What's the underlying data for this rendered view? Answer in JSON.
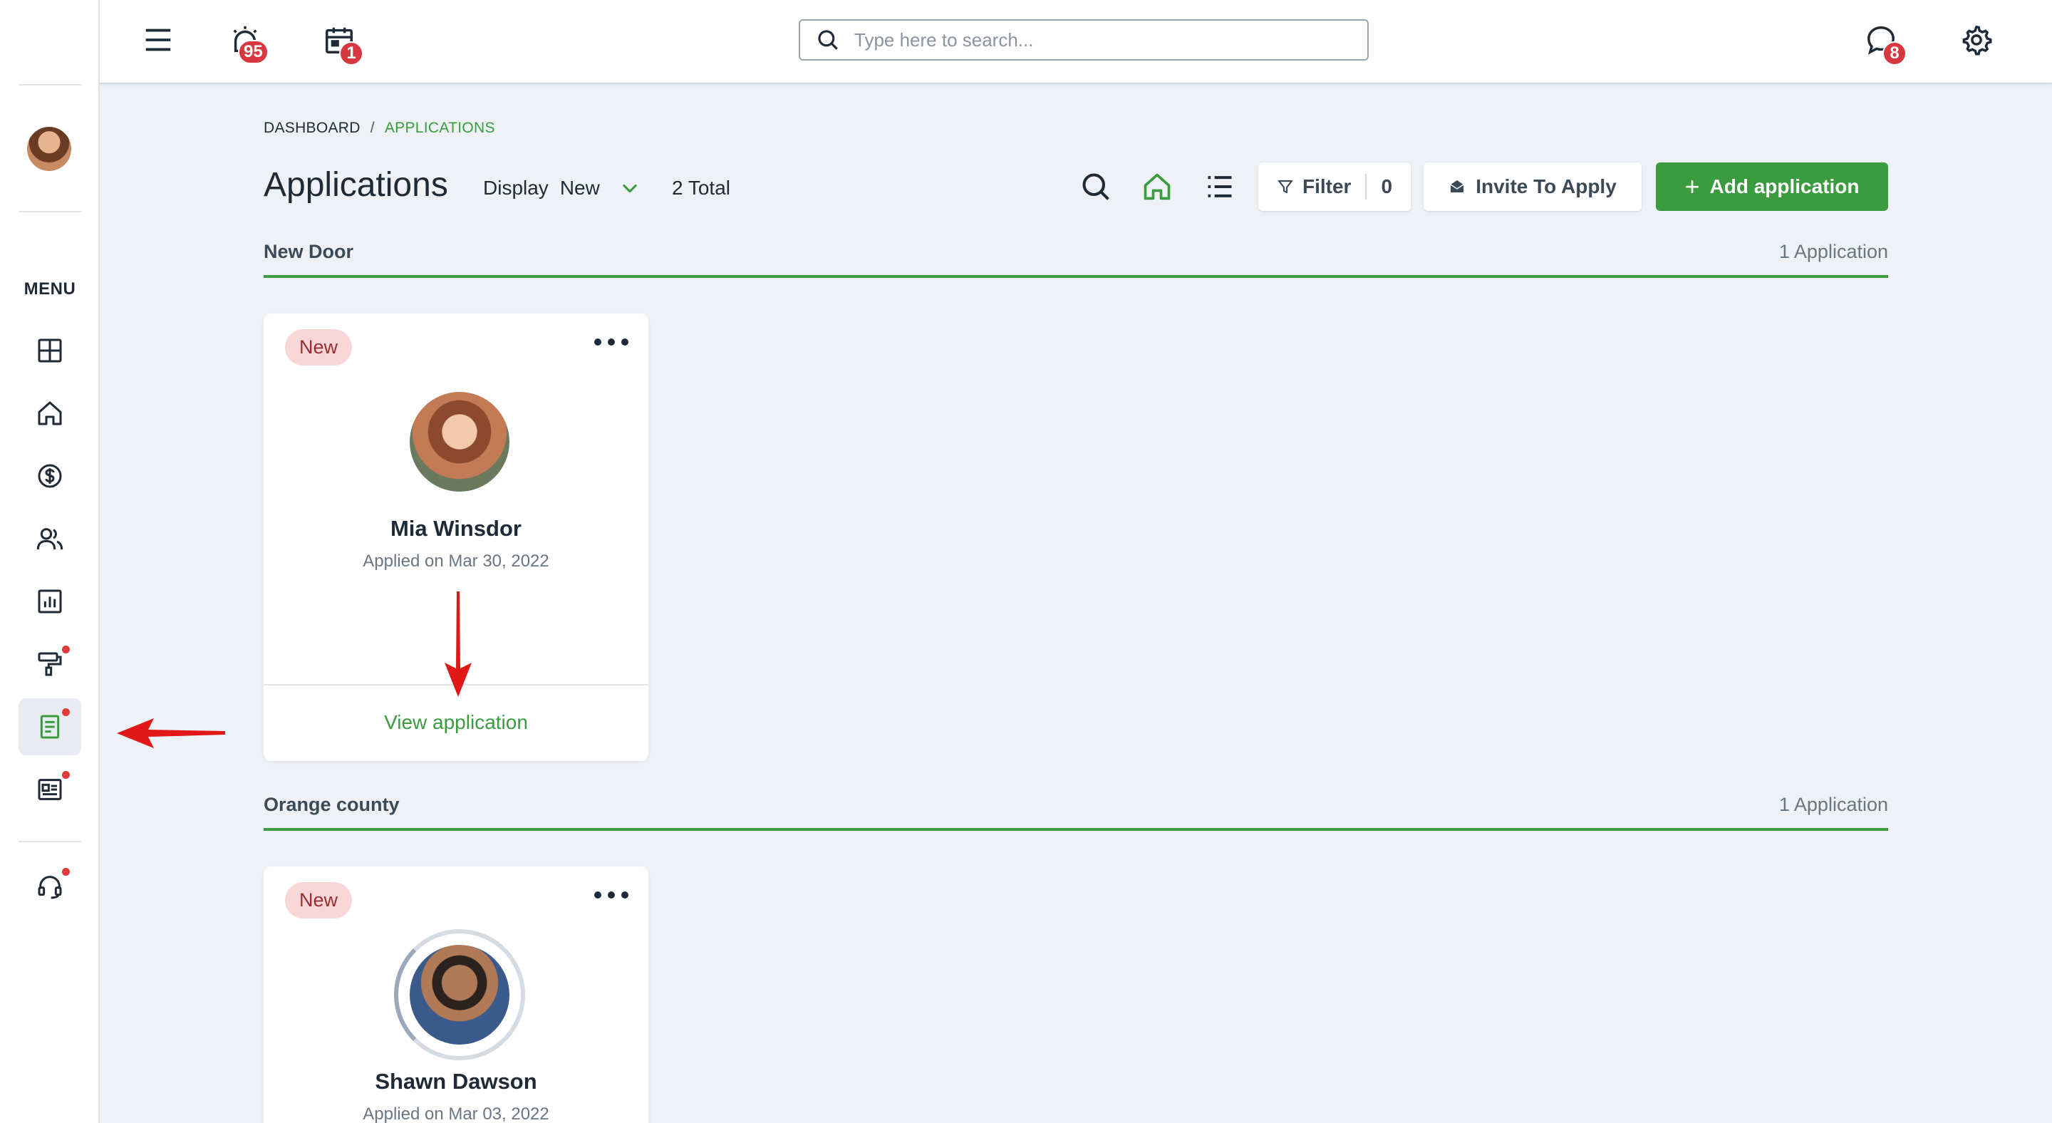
{
  "sidebar": {
    "menu_label": "MENU",
    "items": [
      {
        "name": "dashboard-icon"
      },
      {
        "name": "home-icon"
      },
      {
        "name": "dollar-icon"
      },
      {
        "name": "people-icon"
      },
      {
        "name": "chart-icon"
      },
      {
        "name": "paint-roller-icon",
        "dot": true
      },
      {
        "name": "document-icon",
        "dot": true,
        "active": true
      },
      {
        "name": "newspaper-icon",
        "dot": true
      },
      {
        "name": "headset-icon",
        "dot": true
      }
    ]
  },
  "topbar": {
    "alarm_badge": "95",
    "calendar_badge": "1",
    "chat_badge": "8",
    "search_placeholder": "Type here to search..."
  },
  "breadcrumb": {
    "root": "DASHBOARD",
    "separator": "/",
    "current": "APPLICATIONS"
  },
  "header": {
    "title": "Applications",
    "display_label": "Display",
    "display_value": "New",
    "total": "2 Total",
    "filter_label": "Filter",
    "filter_count": "0",
    "invite_label": "Invite To Apply",
    "add_label": "Add application",
    "add_plus": "+"
  },
  "groups": [
    {
      "name": "New Door",
      "count": "1 Application",
      "card": {
        "status": "New",
        "applicant": "Mia Winsdor",
        "applied": "Applied on Mar 30, 2022",
        "link": "View application"
      }
    },
    {
      "name": "Orange county",
      "count": "1 Application",
      "card": {
        "status": "New",
        "applicant": "Shawn Dawson",
        "applied": "Applied on Mar 03, 2022"
      }
    }
  ],
  "colors": {
    "accent": "#3a9b3f",
    "badge": "#d7373f",
    "annotation_arrow": "#e01818",
    "background": "#eef1f5"
  }
}
